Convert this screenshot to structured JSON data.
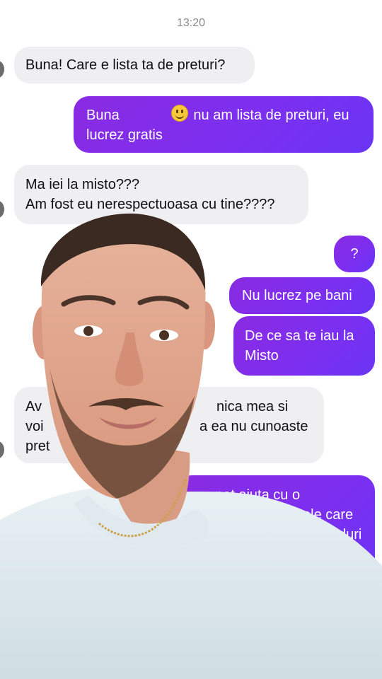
{
  "status_time": "13:20",
  "messages": [
    {
      "side": "in",
      "text_1": "Buna! Care e lista ta de preturi?"
    },
    {
      "side": "out",
      "text_a": "Buna",
      "text_b": "nu am lista de preturi, eu",
      "text_c": "lucrez gratis",
      "emoji": "smiley-face-icon"
    },
    {
      "side": "in",
      "line_1": "Ma iei la misto???",
      "line_2": "Am fost eu nerespectuoasa cu tine????"
    },
    {
      "side": "out",
      "text": "?"
    },
    {
      "side": "out",
      "text": "Nu lucrez pe bani"
    },
    {
      "side": "out",
      "line_1": "De ce sa te iau la",
      "line_2": "Misto"
    },
    {
      "side": "in",
      "line_1_left": "Av",
      "line_1_right": "nica mea si",
      "line_2_left": "voi",
      "line_2_right": "a ea nu cunoaste",
      "line_3_left": "pret"
    },
    {
      "side": "out",
      "line_1": "pot ajuta cu o",
      "line_2": "ele care",
      "line_3": "duri"
    }
  ],
  "colors": {
    "incoming_bg": "#efeff2",
    "outgoing_bg": "#7f2ff0",
    "timestamp": "#8a8a8e"
  },
  "overlay": {
    "subject": "presenter-selfie-video"
  }
}
